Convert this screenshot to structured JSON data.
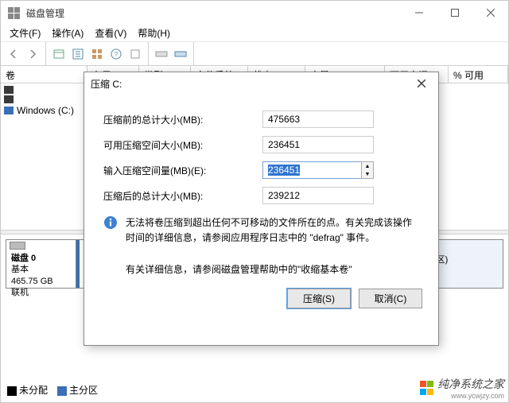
{
  "window": {
    "title": "磁盘管理",
    "menus": [
      "文件(F)",
      "操作(A)",
      "查看(V)",
      "帮助(H)"
    ],
    "columns": {
      "vol": "卷",
      "layout": "布局",
      "type": "类型",
      "fs": "文件系统",
      "status": "状态",
      "capacity": "容量",
      "free": "可用空间",
      "pctfree": "% 可用"
    },
    "volumeEntries": [
      "",
      "",
      "Windows (C:)"
    ],
    "disk": {
      "label": "磁盘 0",
      "type": "基本",
      "size": "465.75 GB",
      "status": "联机",
      "recovery": "(恢复分区)"
    },
    "legend": {
      "unalloc": "未分配",
      "primary": "主分区"
    }
  },
  "dialog": {
    "title": "压缩 C:",
    "labels": {
      "before": "压缩前的总计大小(MB):",
      "available": "可用压缩空间大小(MB):",
      "input": "输入压缩空间量(MB)(E):",
      "after": "压缩后的总计大小(MB):"
    },
    "values": {
      "before": "475663",
      "available": "236451",
      "input": "236451",
      "after": "239212"
    },
    "info": "无法将卷压缩到超出任何不可移动的文件所在的点。有关完成该操作时间的详细信息，请参阅应用程序日志中的 \"defrag\" 事件。",
    "helplink": "有关详细信息，请参阅磁盘管理帮助中的\"收缩基本卷\"",
    "buttons": {
      "ok": "压缩(S)",
      "cancel": "取消(C)"
    }
  },
  "watermark": {
    "text": "纯净系统之家",
    "url": "www.ycwjzy.com"
  }
}
